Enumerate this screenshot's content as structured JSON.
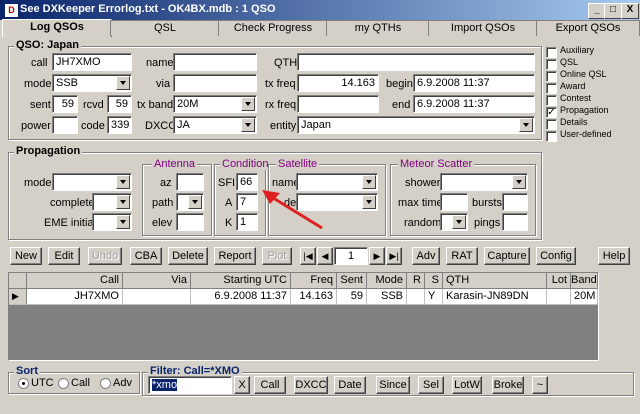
{
  "window": {
    "title": "See DXKeeper Errorlog.txt - OK4BX.mdb : 1 QSO",
    "minimize": "_",
    "maximize": "□",
    "close": "X"
  },
  "tabs": [
    "Log QSOs",
    "QSL",
    "Check Progress",
    "my QTHs",
    "Import QSOs",
    "Export QSOs"
  ],
  "qso": {
    "title": "QSO: Japan",
    "call_label": "call",
    "call": "JH7XMO",
    "name_label": "name",
    "name": "",
    "qth_label": "QTH",
    "qth": "",
    "mode_label": "mode",
    "mode": "SSB",
    "via_label": "via",
    "via": "",
    "txfreq_label": "tx freq",
    "txfreq": "14.163",
    "begin_label": "begin",
    "begin": "6.9.2008   11:37",
    "sent_label": "sent",
    "sent": "59",
    "rcvd_label": "rcvd",
    "rcvd": "59",
    "txband_label": "tx band",
    "txband": "20M",
    "rxfreq_label": "rx freq",
    "rxfreq": "",
    "end_label": "end",
    "end": "6.9.2008   11:37",
    "power_label": "power",
    "power": "",
    "code_label": "code",
    "code": "339",
    "dxcc_label": "DXCC",
    "dxcc": "JA",
    "entity_label": "entity",
    "entity": "Japan"
  },
  "side_checks": [
    {
      "label": "Auxiliary",
      "checked": false
    },
    {
      "label": "QSL",
      "checked": false
    },
    {
      "label": "Online QSL",
      "checked": false
    },
    {
      "label": "Award",
      "checked": false
    },
    {
      "label": "Contest",
      "checked": false
    },
    {
      "label": "Propagation",
      "checked": true
    },
    {
      "label": "Details",
      "checked": false
    },
    {
      "label": "User-defined",
      "checked": false
    }
  ],
  "propagation": {
    "title": "Propagation",
    "mode_label": "mode",
    "complete_label": "complete",
    "eme_label": "EME initial",
    "antenna_title": "Antenna",
    "az_label": "az",
    "path_label": "path",
    "elev_label": "elev",
    "condition_title": "Condition",
    "sfi_label": "SFI",
    "sfi": "66",
    "a_label": "A",
    "a": "7",
    "k_label": "K",
    "k": "1",
    "satellite_title": "Satellite",
    "sat_name_label": "name",
    "sat_mode_label": "de",
    "meteor_title": "Meteor Scatter",
    "shower_label": "shower",
    "maxtime_label": "max time",
    "bursts_label": "bursts",
    "random_label": "random",
    "pings_label": "pings"
  },
  "toolbar": {
    "new": "New",
    "edit": "Edit",
    "undo": "Undo",
    "cba": "CBA",
    "delete": "Delete",
    "report": "Report",
    "plot": "Plot",
    "nav_value": "1",
    "adv": "Adv",
    "rat": "RAT",
    "capture": "Capture",
    "config": "Config",
    "help": "Help"
  },
  "grid": {
    "columns": [
      "Call",
      "Via",
      "Starting UTC",
      "Freq",
      "Sent",
      "Mode",
      "R",
      "S",
      "QTH",
      "Lot",
      "Band"
    ],
    "rows": [
      [
        "JH7XMO",
        "",
        "6.9.2008   11:37",
        "14.163",
        "59",
        "SSB",
        "",
        "Y",
        "Karasin-JN89DN",
        "",
        "20M"
      ]
    ]
  },
  "sort": {
    "title": "Sort",
    "utc": "UTC",
    "call": "Call",
    "adv": "Adv"
  },
  "filter": {
    "title": "Filter: Call=*XMO",
    "value": "*xmo",
    "clear": "X",
    "buttons": [
      "Call",
      "DXCC",
      "Date",
      "Since",
      "Sel",
      "LotW",
      "Broke",
      "~"
    ]
  },
  "colors": {
    "accent_purple": "#800080",
    "arrow_red": "#e02020",
    "title_blue": "#0a246a"
  }
}
